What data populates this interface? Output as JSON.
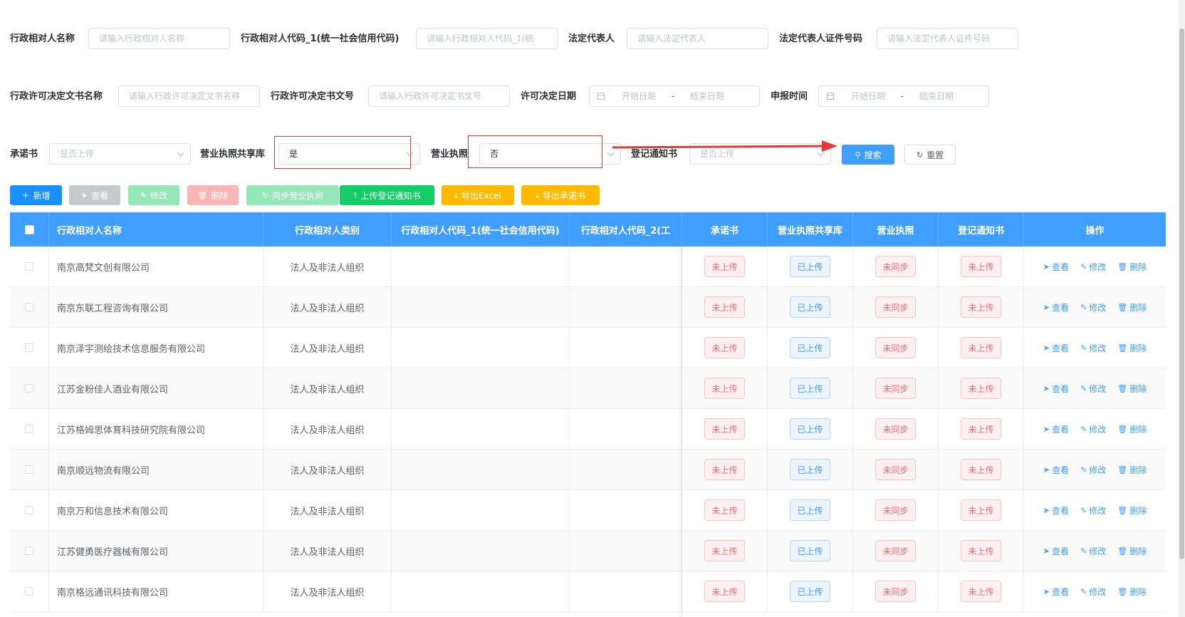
{
  "filters": {
    "row1": [
      {
        "label": "行政相对人名称",
        "placeholder": "请输入行政相对人名称"
      },
      {
        "label": "行政相对人代码_1(统一社会信用代码)",
        "placeholder": "请输入行政相对人代码_1(统"
      },
      {
        "label": "法定代表人",
        "placeholder": "请输入法定代表人"
      },
      {
        "label": "法定代表人证件号码",
        "placeholder": "请输入法定代表人证件号码"
      }
    ],
    "row2": {
      "doc_name_label": "行政许可决定文书名称",
      "doc_name_placeholder": "请输入行政许可决定文书名称",
      "doc_no_label": "行政许可决定书文号",
      "doc_no_placeholder": "请输入行政许可决定书文号",
      "decision_date_label": "许可决定日期",
      "report_time_label": "申报时间",
      "start_placeholder": "开始日期",
      "end_placeholder": "结束日期",
      "range_sep": "-"
    },
    "row3": {
      "promise_label": "承诺书",
      "promise_placeholder": "是否上传",
      "share_label": "营业执照共享库",
      "share_value": "是",
      "license_label": "营业执照",
      "license_value": "否",
      "notice_label": "登记通知书",
      "notice_placeholder": "是否上传",
      "search_label": "搜索",
      "reset_label": "重置"
    }
  },
  "toolbar": {
    "add": "新增",
    "view": "查看",
    "edit": "修改",
    "delete": "删除",
    "sync": "同步营业执照",
    "upload_notice": "上传登记通知书",
    "export_excel": "导出Excel",
    "export_promise": "导出承诺书"
  },
  "colors": {
    "primary": "#409eff",
    "success": "#13ce66",
    "warning": "#ffba00",
    "danger": "#f56c6c",
    "annotation_red": "#e53935"
  },
  "table": {
    "headers": {
      "name": "行政相对人名称",
      "category": "行政相对人类别",
      "code1": "行政相对人代码_1(统一社会信用代码)",
      "code2": "行政相对人代码_2(工",
      "promise": "承诺书",
      "share": "营业执照共享库",
      "license": "营业执照",
      "notice": "登记通知书",
      "ops": "操作"
    },
    "ops": {
      "view": "查看",
      "edit": "修改",
      "delete": "删除"
    },
    "rows": [
      {
        "name": "南京高梵文创有限公司",
        "category": "法人及非法人组织",
        "promise": "未上传",
        "share": "已上传",
        "license": "未同步",
        "notice": "未上传"
      },
      {
        "name": "南京东联工程咨询有限公司",
        "category": "法人及非法人组织",
        "promise": "未上传",
        "share": "已上传",
        "license": "未同步",
        "notice": "未上传"
      },
      {
        "name": "南京泽宇测绘技术信息服务有限公司",
        "category": "法人及非法人组织",
        "promise": "未上传",
        "share": "已上传",
        "license": "未同步",
        "notice": "未上传"
      },
      {
        "name": "江苏金粉佳人酒业有限公司",
        "category": "法人及非法人组织",
        "promise": "未上传",
        "share": "已上传",
        "license": "未同步",
        "notice": "未上传"
      },
      {
        "name": "江苏格姆思体育科技研究院有限公司",
        "category": "法人及非法人组织",
        "promise": "未上传",
        "share": "已上传",
        "license": "未同步",
        "notice": "未上传"
      },
      {
        "name": "南京顺远物流有限公司",
        "category": "法人及非法人组织",
        "promise": "未上传",
        "share": "已上传",
        "license": "未同步",
        "notice": "未上传"
      },
      {
        "name": "南京万和信息技术有限公司",
        "category": "法人及非法人组织",
        "promise": "未上传",
        "share": "已上传",
        "license": "未同步",
        "notice": "未上传"
      },
      {
        "name": "江苏健勇医疗器械有限公司",
        "category": "法人及非法人组织",
        "promise": "未上传",
        "share": "已上传",
        "license": "未同步",
        "notice": "未上传"
      },
      {
        "name": "南京格远通讯科技有限公司",
        "category": "法人及非法人组织",
        "promise": "未上传",
        "share": "已上传",
        "license": "未同步",
        "notice": "未上传"
      }
    ]
  }
}
